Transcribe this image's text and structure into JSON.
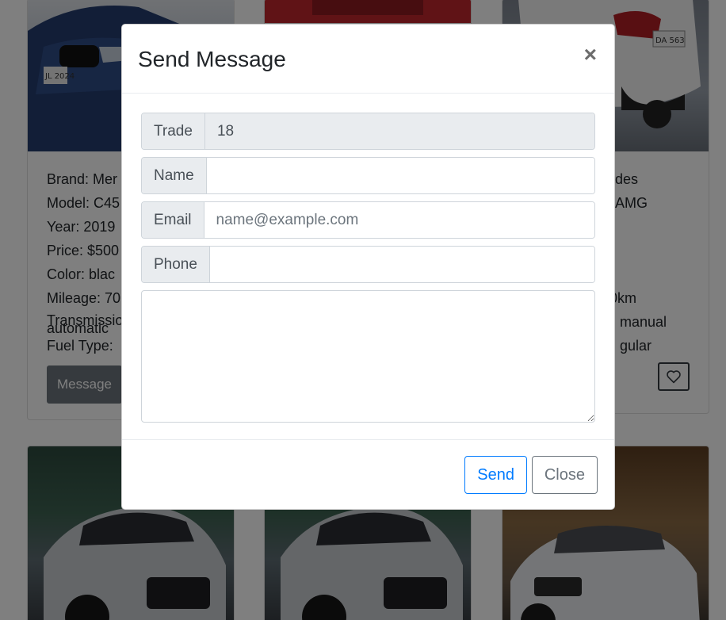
{
  "modal": {
    "title": "Send Message",
    "close_symbol": "×",
    "fields": {
      "trade_label": "Trade",
      "trade_value": "18",
      "name_label": "Name",
      "name_value": "",
      "email_label": "Email",
      "email_placeholder": "name@example.com",
      "phone_label": "Phone",
      "phone_value": "",
      "message_value": ""
    },
    "send_label": "Send",
    "close_label": "Close"
  },
  "listing": {
    "cards": [
      {
        "brand": "Brand: Mer",
        "model": "Model: C45",
        "year": "Year: 2019",
        "price": "Price: $500",
        "color": "Color: blac",
        "mileage": "Mileage: 70",
        "transmission": "Transmissio",
        "transmission_value": "automatic",
        "fuel": "Fuel Type: ",
        "message_label": "Message"
      },
      {
        "brand": "des",
        "model": "AMG",
        "mileage": "0km",
        "transmission": "manual",
        "fuel": "gular"
      }
    ]
  },
  "colors": {
    "primary": "#007bff",
    "secondary": "#6c757d",
    "addon_bg": "#e9ecef",
    "border": "#ced4da"
  }
}
